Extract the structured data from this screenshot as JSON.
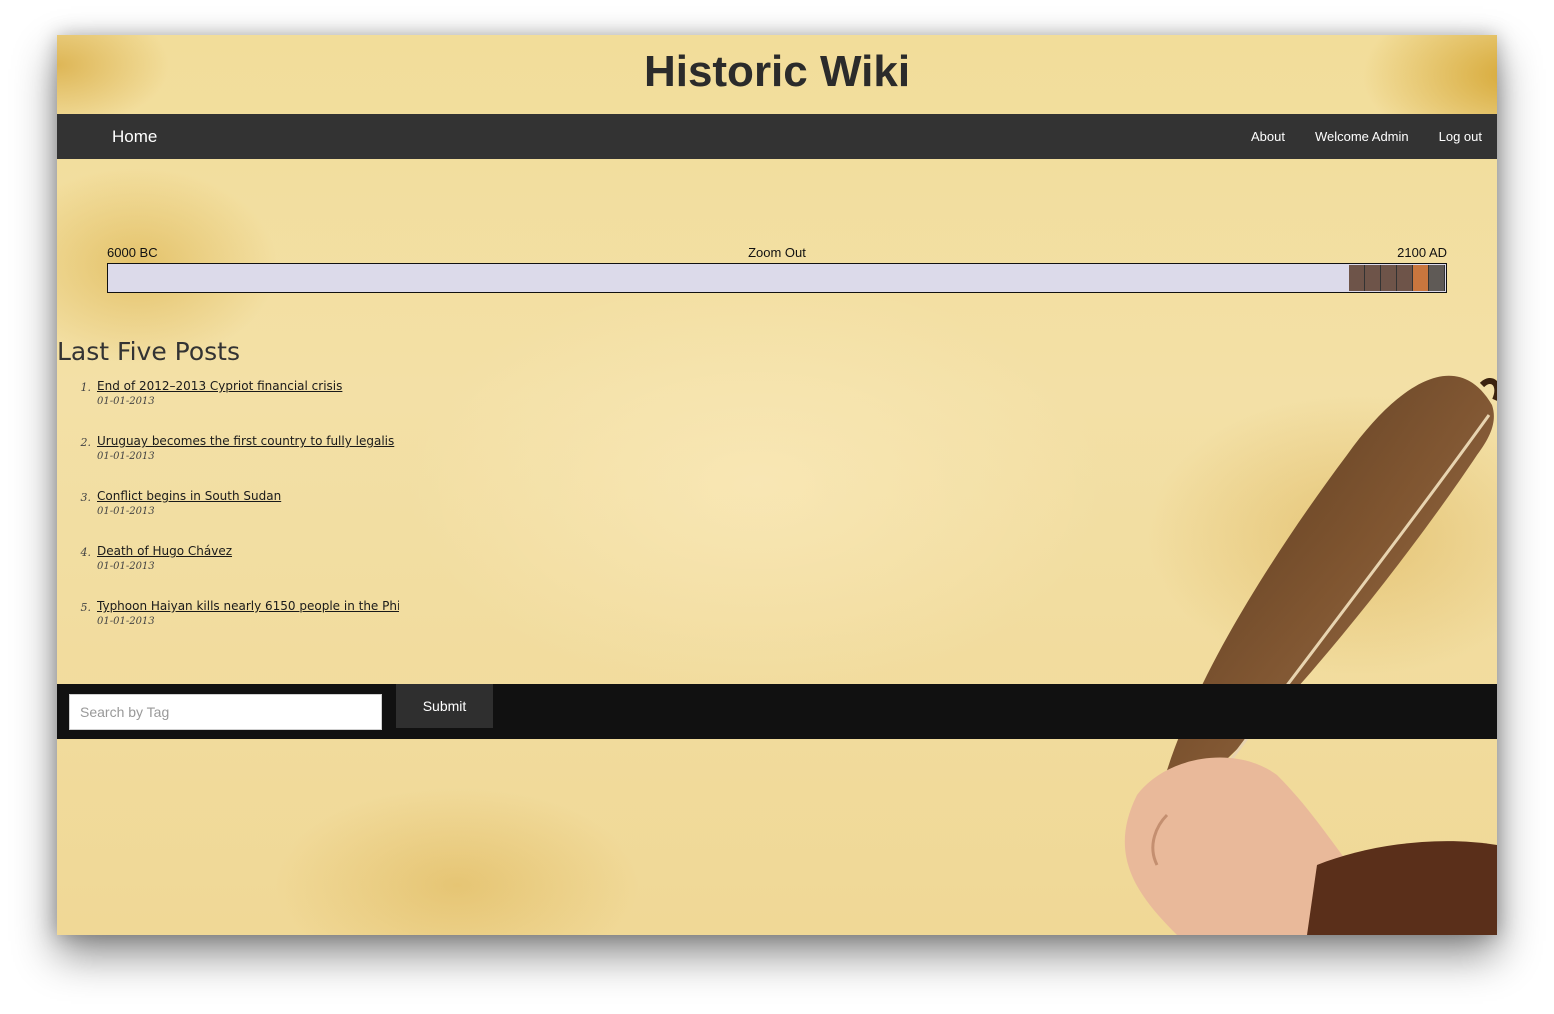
{
  "site": {
    "title": "Historic Wiki"
  },
  "nav": {
    "home": "Home",
    "links": [
      "About",
      "Welcome Admin",
      "Log out"
    ]
  },
  "timeline": {
    "start_label": "6000 BC",
    "zoom_label": "Zoom Out",
    "end_label": "2100 AD",
    "block_colors": [
      "#6e5449",
      "#6e5449",
      "#6e5449",
      "#6e5449",
      "#c9763e",
      "#5f5a56"
    ]
  },
  "posts": {
    "heading": "Last Five Posts",
    "items": [
      {
        "num": "1.",
        "title": "End of 2012–2013 Cypriot financial crisis",
        "date": "01-01-2013"
      },
      {
        "num": "2.",
        "title": "Uruguay becomes the first country to fully legalis",
        "date": "01-01-2013"
      },
      {
        "num": "3.",
        "title": "Conflict begins in South Sudan",
        "date": "01-01-2013"
      },
      {
        "num": "4.",
        "title": "Death of Hugo Chávez",
        "date": "01-01-2013"
      },
      {
        "num": "5.",
        "title": "Typhoon Haiyan kills nearly 6150 people in the Phi",
        "date": "01-01-2013"
      }
    ]
  },
  "search": {
    "placeholder": "Search by Tag",
    "submit_label": "Submit"
  }
}
